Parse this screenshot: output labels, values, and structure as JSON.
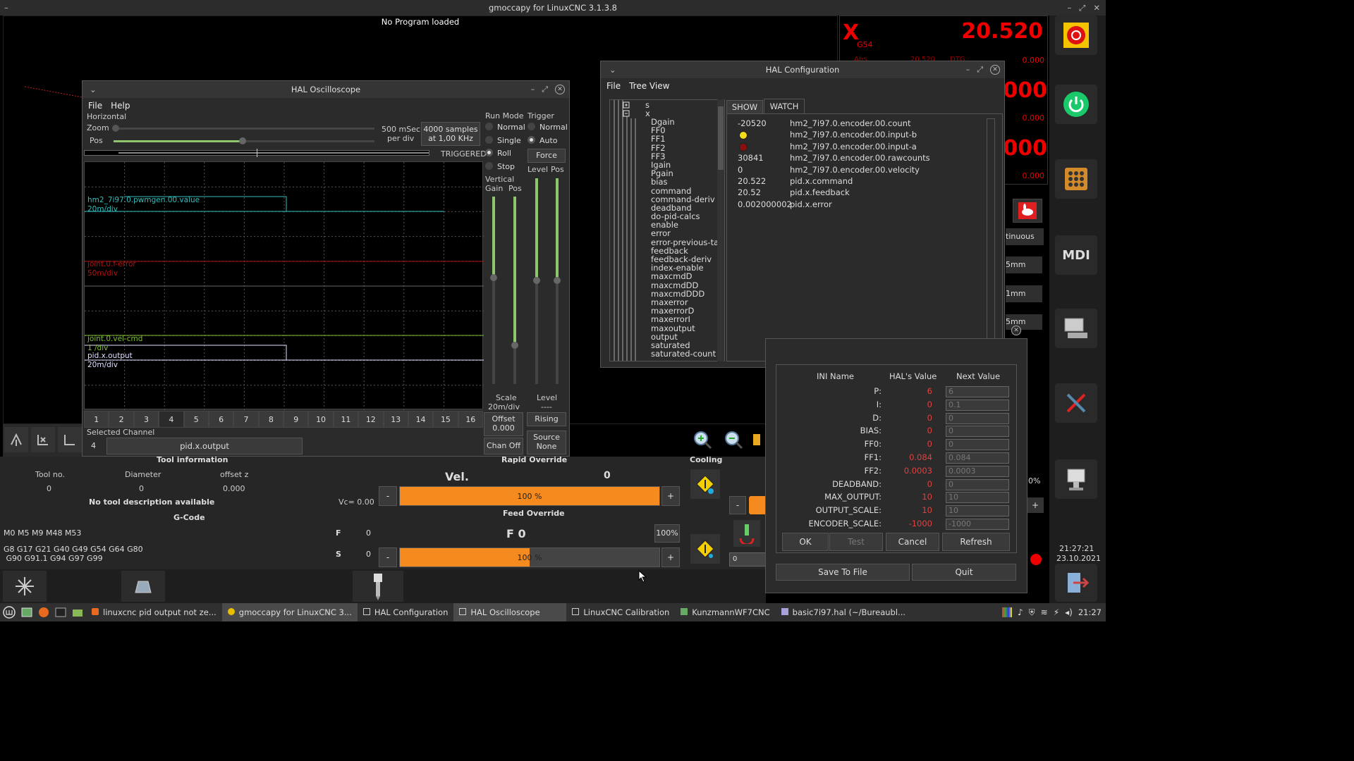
{
  "app": {
    "title": "gmoccapy for LinuxCNC  3.1.3.8",
    "program_status": "No Program loaded"
  },
  "dro": {
    "axis": "X",
    "coord_system": "G54",
    "value": "20.520",
    "abs_label": "Abs",
    "abs_value": "20.520",
    "dtg_label": "DTG",
    "row_values": [
      "0.000",
      "0.000",
      "0.000",
      "0.000"
    ],
    "big_values": [
      ".000",
      ".000"
    ]
  },
  "scope": {
    "title": "HAL Oscilloscope",
    "menu": [
      "File",
      "Help"
    ],
    "horizontal_label": "Horizontal",
    "zoom_label": "Zoom",
    "pos_label": "Pos",
    "time_per_div": "500 mSec",
    "per_div": "per div",
    "samples": "4000 samples",
    "rate": "at 1,00 KHz",
    "triggered": "TRIGGERED",
    "run_mode_label": "Run Mode",
    "run_modes": [
      "Normal",
      "Single",
      "Roll",
      "Stop"
    ],
    "trigger_label": "Trigger",
    "trigger_modes": [
      "Normal",
      "Auto"
    ],
    "force": "Force",
    "level_label": "Level",
    "pos_label2": "Pos",
    "vertical_label": "Vertical",
    "gain_label": "Gain",
    "vpos_label": "Pos",
    "traces": [
      {
        "name": "hm2_7i97.0.pwmgen.00.value",
        "scale": "20m/div",
        "color": "#2fbfbf"
      },
      {
        "name": "joint.0.f-error",
        "scale": "50m/div",
        "color": "#b01010"
      },
      {
        "name": "joint.0.vel-cmd",
        "scale": "1 /div",
        "color": "#7fbf2f"
      },
      {
        "name": "pid.x.output",
        "scale": "20m/div",
        "color": "#e0e0ff"
      }
    ],
    "channels": [
      "1",
      "2",
      "3",
      "4",
      "5",
      "6",
      "7",
      "8",
      "9",
      "10",
      "11",
      "12",
      "13",
      "14",
      "15",
      "16"
    ],
    "scale_label": "Scale",
    "scale_value": "20m/div",
    "level_bottom": "Level",
    "level_value": "----",
    "offset_label": "Offset",
    "offset_value": "0.000",
    "rising": "Rising",
    "selected_channel_label": "Selected Channel",
    "selected_channel_num": "4",
    "selected_channel_name": "pid.x.output",
    "chan_off": "Chan Off",
    "source_label": "Source",
    "source_value": "None"
  },
  "halconf": {
    "title": "HAL Configuration",
    "menu": [
      "File",
      "Tree View"
    ],
    "tabs": [
      "SHOW",
      "WATCH"
    ],
    "tree_top": [
      "s",
      "x"
    ],
    "tree_items": [
      "Dgain",
      "FF0",
      "FF1",
      "FF2",
      "FF3",
      "Igain",
      "Pgain",
      "bias",
      "command",
      "command-deriv",
      "deadband",
      "do-pid-calcs",
      "enable",
      "error",
      "error-previous-ta",
      "feedback",
      "feedback-deriv",
      "index-enable",
      "maxcmdD",
      "maxcmdDD",
      "maxcmdDDD",
      "maxerror",
      "maxerrorD",
      "maxerrorI",
      "maxoutput",
      "output",
      "saturated",
      "saturated-count"
    ],
    "watch": [
      {
        "value": "-20520",
        "name": "hm2_7i97.0.encoder.00.count",
        "kind": "text"
      },
      {
        "value": "",
        "name": "hm2_7i97.0.encoder.00.input-b",
        "kind": "led-yellow"
      },
      {
        "value": "",
        "name": "hm2_7i97.0.encoder.00.input-a",
        "kind": "led-red"
      },
      {
        "value": "30841",
        "name": "hm2_7i97.0.encoder.00.rawcounts",
        "kind": "text"
      },
      {
        "value": "0",
        "name": "hm2_7i97.0.encoder.00.velocity",
        "kind": "text"
      },
      {
        "value": "20.522",
        "name": "pid.x.command",
        "kind": "text"
      },
      {
        "value": "20.52",
        "name": "pid.x.feedback",
        "kind": "text"
      },
      {
        "value": "0.002000002",
        "name": "pid.x.error",
        "kind": "text"
      }
    ]
  },
  "calibration": {
    "headers": [
      "INI Name",
      "HAL's Value",
      "Next Value"
    ],
    "rows": [
      {
        "name": "P:",
        "hal": "6",
        "next": "6"
      },
      {
        "name": "I:",
        "hal": "0",
        "next": "0.1"
      },
      {
        "name": "D:",
        "hal": "0",
        "next": "0"
      },
      {
        "name": "BIAS:",
        "hal": "0",
        "next": "0"
      },
      {
        "name": "FF0:",
        "hal": "0",
        "next": "0"
      },
      {
        "name": "FF1:",
        "hal": "0.084",
        "next": "0.084"
      },
      {
        "name": "FF2:",
        "hal": "0.0003",
        "next": "0.0003"
      },
      {
        "name": "DEADBAND:",
        "hal": "0",
        "next": "0"
      },
      {
        "name": "MAX_OUTPUT:",
        "hal": "10",
        "next": "10"
      },
      {
        "name": "OUTPUT_SCALE:",
        "hal": "10",
        "next": "10"
      },
      {
        "name": "ENCODER_SCALE:",
        "hal": "-1000",
        "next": "-1000"
      }
    ],
    "buttons": {
      "ok": "OK",
      "test": "Test",
      "cancel": "Cancel",
      "refresh": "Refresh",
      "save": "Save To File",
      "quit": "Quit"
    }
  },
  "right_partials": {
    "continuous": "tinuous",
    "step1": "5mm",
    "step2": "1mm",
    "step3": "5mm",
    "pct": "0%"
  },
  "tool": {
    "title": "Tool information",
    "headers": [
      "Tool no.",
      "Diameter",
      "offset z"
    ],
    "values": [
      "0",
      "0",
      "0.000"
    ],
    "desc": "No tool description available",
    "vc": "Vc= 0.00"
  },
  "gcode": {
    "title": "G-Code",
    "line1": "M0 M5 M9 M48 M53",
    "line2": "G8 G17 G21 G40 G49 G54 G64 G80",
    "line3": " G90 G91.1 G94 G97 G99",
    "f_label": "F",
    "f_value": "0",
    "s_label": "S",
    "s_value": "0"
  },
  "rapid": {
    "title": "Rapid Override",
    "vel_label": "Vel.",
    "vel_value": "0",
    "percent": "100 %",
    "fill": 1.0,
    "minus": "-",
    "plus": "+"
  },
  "feed": {
    "title": "Feed Override",
    "f_label": "F 0",
    "pct_btn": "100%",
    "percent": "100 %",
    "fill": 0.5,
    "minus": "-",
    "plus": "+"
  },
  "cooling": {
    "title": "Cooling"
  },
  "spindle_entry": "0",
  "clock": {
    "time": "21:27:21",
    "date": "23.10.2021"
  },
  "taskbar": {
    "items": [
      "linuxcnc pid output not ze...",
      "gmoccapy for LinuxCNC  3...",
      "HAL Configuration",
      "HAL Oscilloscope",
      "LinuxCNC Calibration",
      "KunzmannWF7CNC",
      "basic7i97.hal (~/Bureaubl..."
    ],
    "time": "21:27"
  }
}
